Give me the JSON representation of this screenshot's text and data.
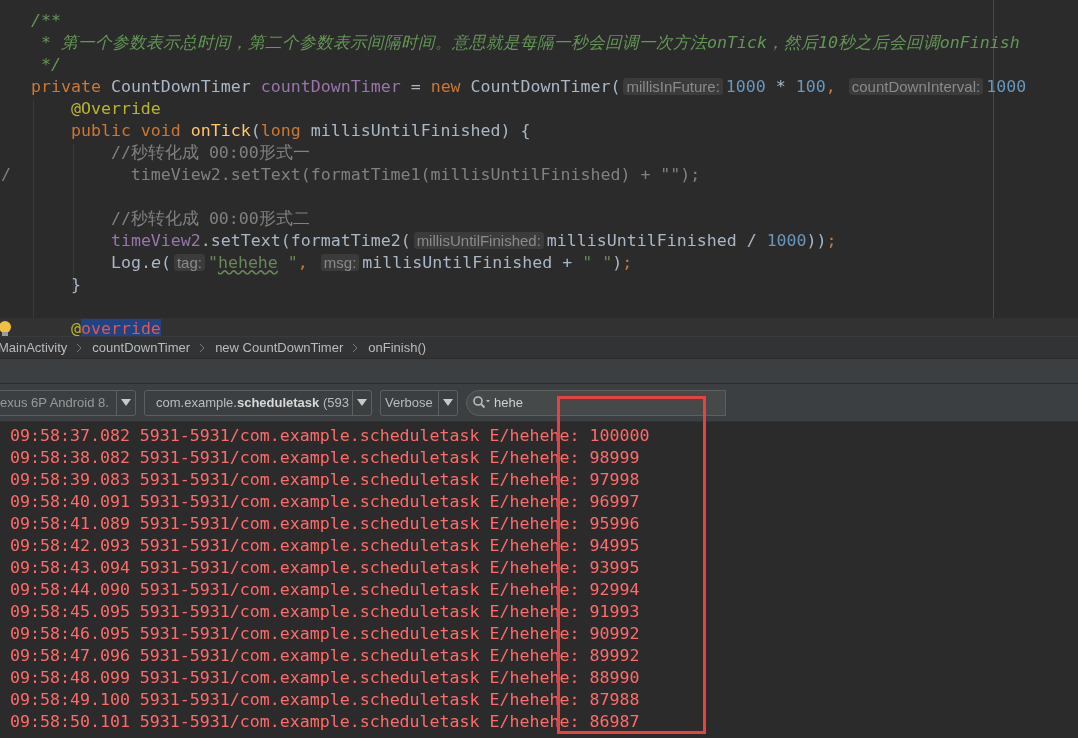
{
  "editor": {
    "lines": [
      {
        "current": false,
        "bulb": false,
        "tokens": [
          {
            "kind": "doc",
            "text": "   /**"
          }
        ]
      },
      {
        "current": false,
        "bulb": false,
        "tokens": [
          {
            "kind": "doc",
            "text": "    * 第一个参数表示总时间，第二个参数表示间隔时间。意思就是每隔一秒会回调一次方法onTick，然后10秒之后会回调onFinish"
          }
        ]
      },
      {
        "current": false,
        "bulb": false,
        "tokens": [
          {
            "kind": "doc",
            "text": "    */"
          }
        ]
      },
      {
        "current": false,
        "bulb": false,
        "tokens": [
          {
            "kind": "keyword",
            "text": "   private "
          },
          {
            "kind": "plain",
            "text": "CountDownTimer "
          },
          {
            "kind": "field",
            "text": "countDownTimer"
          },
          {
            "kind": "plain",
            "text": " = "
          },
          {
            "kind": "keyword",
            "text": "new "
          },
          {
            "kind": "plain",
            "text": "CountDownTimer("
          },
          {
            "kind": "hint",
            "text": "millisInFuture:"
          },
          {
            "kind": "number",
            "text": "1000"
          },
          {
            "kind": "plain",
            "text": " * "
          },
          {
            "kind": "number",
            "text": "100"
          },
          {
            "kind": "keyword",
            "text": ", "
          },
          {
            "kind": "hint",
            "text": "countDownInterval:"
          },
          {
            "kind": "number",
            "text": "1000"
          }
        ]
      },
      {
        "current": false,
        "bulb": false,
        "tokens": [
          {
            "kind": "annotation",
            "text": "       @Override"
          }
        ]
      },
      {
        "current": false,
        "bulb": false,
        "tokens": [
          {
            "kind": "keyword",
            "text": "       public void "
          },
          {
            "kind": "method",
            "text": "onTick"
          },
          {
            "kind": "plain",
            "text": "("
          },
          {
            "kind": "keyword",
            "text": "long "
          },
          {
            "kind": "plain",
            "text": "millisUntilFinished) {"
          }
        ]
      },
      {
        "current": false,
        "bulb": false,
        "tokens": [
          {
            "kind": "comment",
            "text": "           //秒转化成 00:00形式一"
          }
        ]
      },
      {
        "current": false,
        "bulb": false,
        "tokens": [
          {
            "kind": "comment",
            "text": "/            timeView2.setText(formatTime1(millisUntilFinished) + \"\");"
          }
        ]
      },
      {
        "current": false,
        "bulb": false
      },
      {
        "current": false,
        "bulb": false,
        "tokens": [
          {
            "kind": "comment",
            "text": "           //秒转化成 00:00形式二"
          }
        ]
      },
      {
        "current": false,
        "bulb": false,
        "tokens": [
          {
            "kind": "field",
            "text": "           timeView2"
          },
          {
            "kind": "plain",
            "text": ".setText(formatTime2("
          },
          {
            "kind": "hint",
            "text": "millisUntilFinished:"
          },
          {
            "kind": "plain",
            "text": "millisUntilFinished / "
          },
          {
            "kind": "number",
            "text": "1000"
          },
          {
            "kind": "plain",
            "text": "))"
          },
          {
            "kind": "keyword",
            "text": ";"
          }
        ]
      },
      {
        "current": false,
        "bulb": false,
        "tokens": [
          {
            "kind": "plain",
            "text": "           Log."
          },
          {
            "kind": "static",
            "text": "e"
          },
          {
            "kind": "plain",
            "text": "("
          },
          {
            "kind": "hint",
            "text": "tag:"
          },
          {
            "kind": "string",
            "text": "\""
          },
          {
            "kind": "typo",
            "text": "hehehe"
          },
          {
            "kind": "string",
            "text": " \""
          },
          {
            "kind": "keyword",
            "text": ", "
          },
          {
            "kind": "hint",
            "text": "msg:"
          },
          {
            "kind": "plain",
            "text": "millisUntilFinished + "
          },
          {
            "kind": "string",
            "text": "\" \""
          },
          {
            "kind": "plain",
            "text": ")"
          },
          {
            "kind": "keyword",
            "text": ";"
          }
        ]
      },
      {
        "current": false,
        "bulb": false,
        "tokens": [
          {
            "kind": "plain",
            "text": "       }"
          }
        ]
      },
      {
        "current": false,
        "bulb": false
      },
      {
        "current": true,
        "bulb": true,
        "tokens": [
          {
            "kind": "annotation",
            "text": "       @"
          },
          {
            "kind": "selected",
            "text": "override"
          }
        ]
      }
    ]
  },
  "breadcrumbs": [
    "MainActivity",
    "countDownTimer",
    "new CountDownTimer",
    "onFinish()"
  ],
  "logcat": {
    "device": "exus 6P Android 8.",
    "process": "com.example.**scheduletask** (593",
    "level": "Verbose",
    "search": "hehe",
    "lines": [
      "09:58:37.082 5931-5931/com.example.scheduletask E/hehehe: 100000",
      "09:58:38.082 5931-5931/com.example.scheduletask E/hehehe: 98999",
      "09:58:39.083 5931-5931/com.example.scheduletask E/hehehe: 97998",
      "09:58:40.091 5931-5931/com.example.scheduletask E/hehehe: 96997",
      "09:58:41.089 5931-5931/com.example.scheduletask E/hehehe: 95996",
      "09:58:42.093 5931-5931/com.example.scheduletask E/hehehe: 94995",
      "09:58:43.094 5931-5931/com.example.scheduletask E/hehehe: 93995",
      "09:58:44.090 5931-5931/com.example.scheduletask E/hehehe: 92994",
      "09:58:45.095 5931-5931/com.example.scheduletask E/hehehe: 91993",
      "09:58:46.095 5931-5931/com.example.scheduletask E/hehehe: 90992",
      "09:58:47.096 5931-5931/com.example.scheduletask E/hehehe: 89992",
      "09:58:48.099 5931-5931/com.example.scheduletask E/hehehe: 88990",
      "09:58:49.100 5931-5931/com.example.scheduletask E/hehehe: 87988",
      "09:58:50.101 5931-5931/com.example.scheduletask E/hehehe: 86987"
    ]
  },
  "highlight_box": {
    "kind": "rectangle"
  }
}
